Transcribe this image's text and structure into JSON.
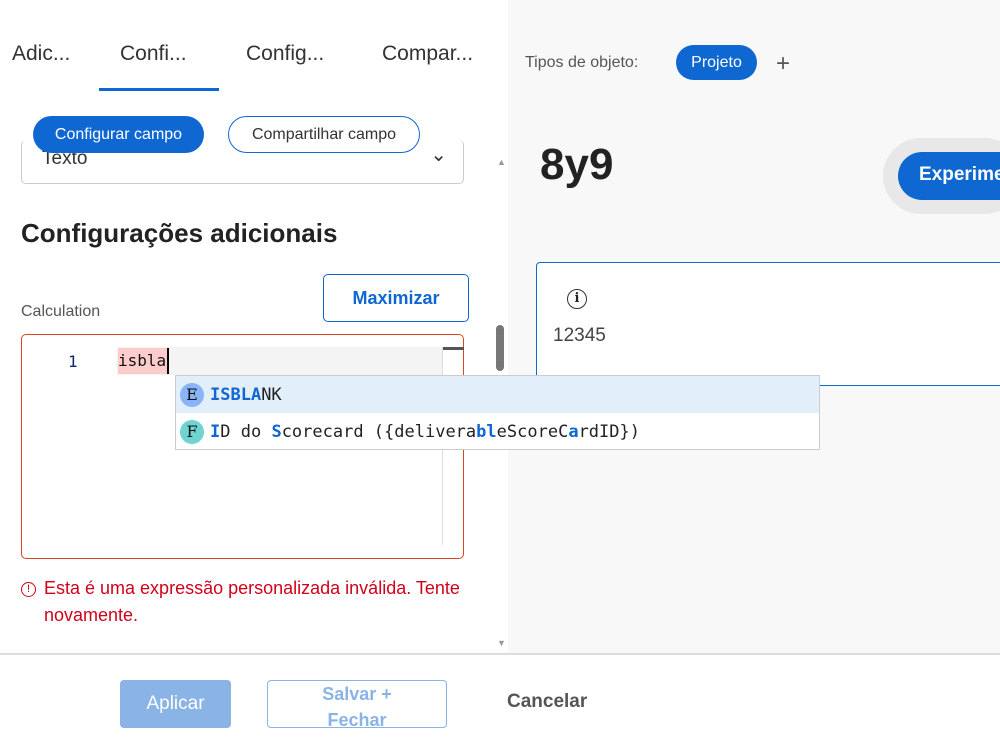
{
  "tabs": [
    {
      "label": "Adic..."
    },
    {
      "label": "Confi..."
    },
    {
      "label": "Config..."
    },
    {
      "label": "Compar..."
    }
  ],
  "pills": {
    "configure": "Configurar campo",
    "share": "Compartilhar campo"
  },
  "field_type": {
    "value": "Texto"
  },
  "section_title": "Configurações adicionais",
  "calculation": {
    "label": "Calculation",
    "maximize": "Maximizar",
    "line_number": "1",
    "code": "isbla"
  },
  "autocomplete": [
    {
      "badge": "E",
      "badge_color": "#8ab4f8",
      "segments": [
        {
          "t": "ISBLA",
          "h": true
        },
        {
          "t": "NK",
          "h": false
        }
      ]
    },
    {
      "badge": "F",
      "badge_color": "#6fd3cf",
      "segments": [
        {
          "t": "I",
          "h": true
        },
        {
          "t": "D do ",
          "h": false
        },
        {
          "t": "S",
          "h": true
        },
        {
          "t": "corecard ({deliver",
          "h": false
        },
        {
          "t": "a",
          "h": false
        },
        {
          "t": "bl",
          "h": true
        },
        {
          "t": "eScoreC",
          "h": false
        },
        {
          "t": "a",
          "h": true
        },
        {
          "t": "rdID})",
          "h": false
        }
      ]
    }
  ],
  "error": {
    "icon": "exclamation-circle",
    "message": "Esta é uma expressão personalizada inválida. Tente novamente."
  },
  "footer": {
    "apply": "Aplicar",
    "save_close": "Salvar + Fechar",
    "cancel": "Cancelar"
  },
  "preview": {
    "object_types_label": "Tipos de objeto:",
    "object_type": "Projeto",
    "add": "+",
    "title": "8y9",
    "experiment_button": "Experimente",
    "card_value": "12345"
  },
  "colors": {
    "accent": "#0f67d1",
    "error": "#d0021b"
  }
}
